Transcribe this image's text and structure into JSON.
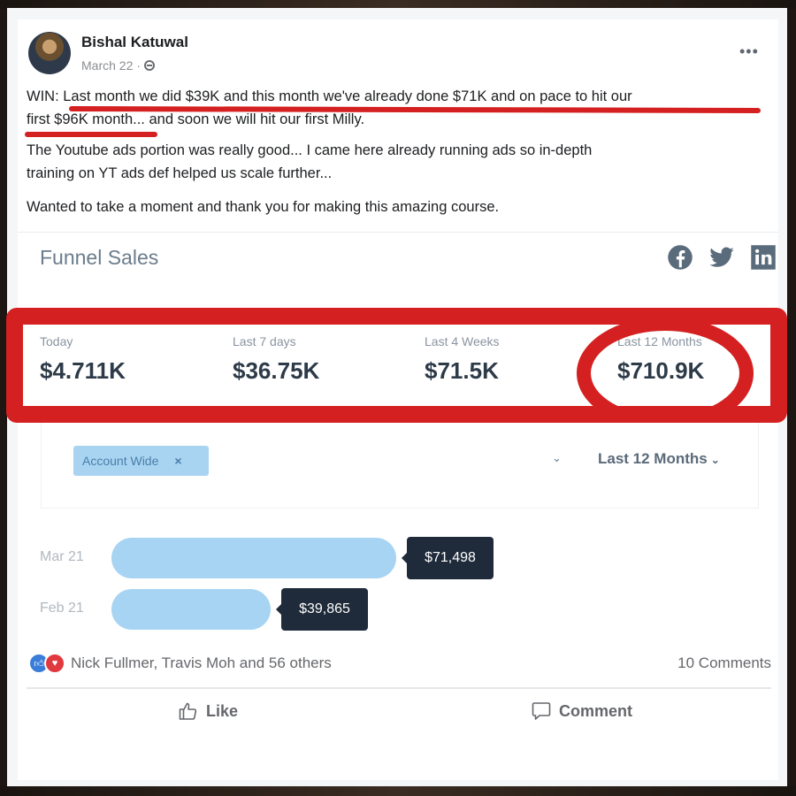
{
  "post": {
    "author": "Bishal Katuwal",
    "date": "March 22",
    "separator": "·",
    "privacy_icon": "globe-icon",
    "more_label": "•••",
    "lines": [
      "WIN:  Last month we did $39K and this month we've already done $71K and on pace to hit our",
      "first $96K month... and soon we will hit our first Milly.",
      "The Youtube ads portion was really good... I came here already running ads so in-depth",
      "training on YT ads def helped us scale further...",
      "Wanted to take a moment and thank you for making this amazing course."
    ]
  },
  "embed": {
    "title": "Funnel Sales",
    "social_icons": [
      "facebook-icon",
      "twitter-icon",
      "linkedin-icon"
    ],
    "stats": [
      {
        "label": "Today",
        "value": "$4.711K"
      },
      {
        "label": "Last 7 days",
        "value": "$36.75K"
      },
      {
        "label": "Last 4 Weeks",
        "value": "$71.5K"
      },
      {
        "label": "Last 12 Months",
        "value": "$710.9K"
      }
    ],
    "filter": {
      "tag_label": "Account Wide",
      "tag_remove": "×",
      "dropdown_chevron": "⌄",
      "period_label": "Last 12 Months",
      "period_chevron": "⌄"
    }
  },
  "chart_data": {
    "type": "bar",
    "orientation": "horizontal",
    "categories": [
      "Mar 21",
      "Feb 21"
    ],
    "values": [
      71498,
      39865
    ],
    "value_labels": [
      "$71,498",
      "$39,865"
    ],
    "title": "",
    "xlabel": "",
    "ylabel": "",
    "color": "#a6d4f2"
  },
  "footer": {
    "reactions_text": "Nick Fullmer, Travis Moh and 56 others",
    "comments_count": "10 Comments",
    "like_label": "Like",
    "comment_label": "Comment"
  },
  "colors": {
    "annotation_red": "#d42020",
    "tooltip_bg": "#1f2b3a",
    "bar_fill": "#a6d4f2",
    "like_blue": "#3a7dd8",
    "love_red": "#e0393e"
  }
}
